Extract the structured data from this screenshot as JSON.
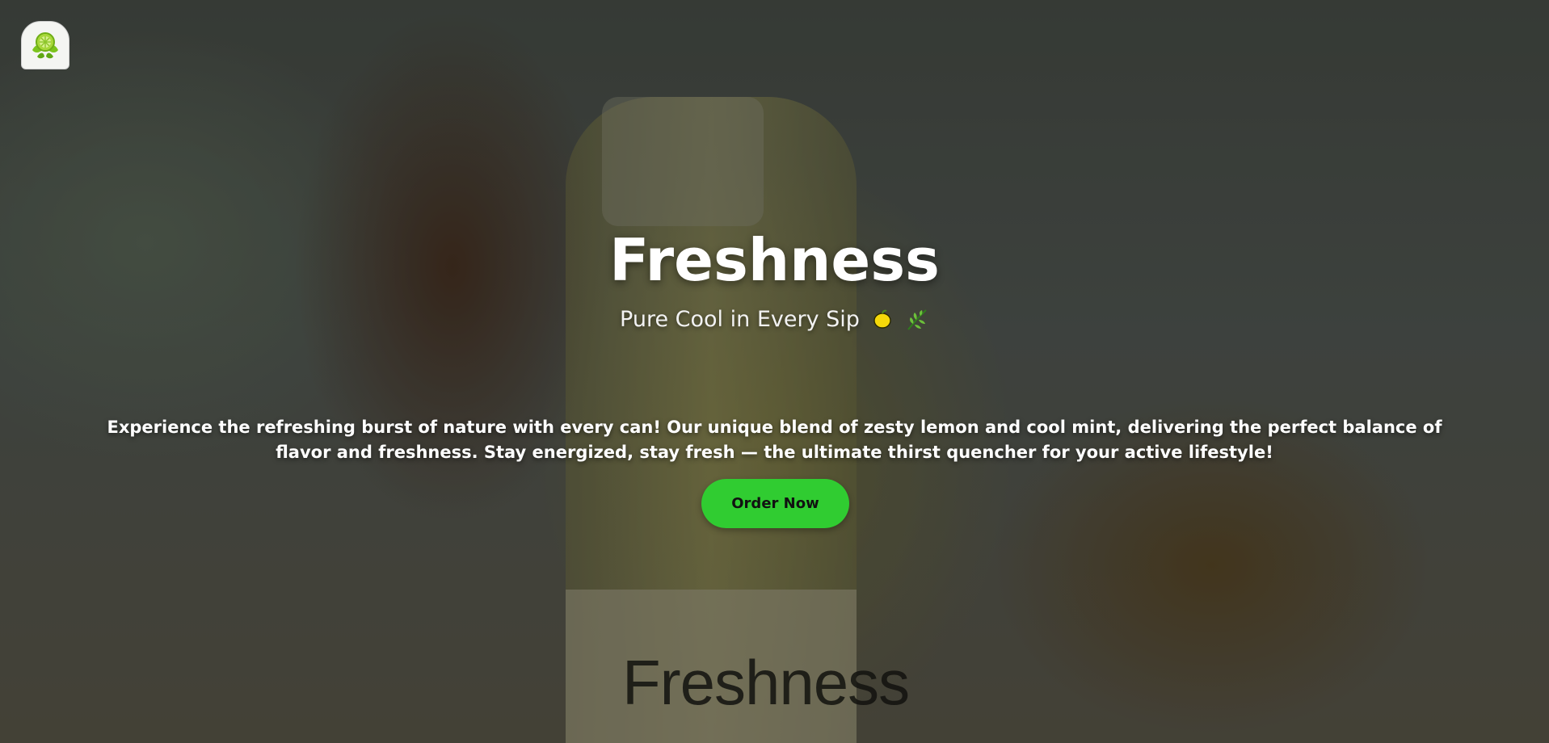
{
  "hero": {
    "logo_icon": "lime-leaves-logo-icon",
    "background_label_text": "Freshness",
    "title": "Freshness",
    "subtitle": "Pure Cool in Every Sip",
    "subtitle_icons": [
      "lemon-icon",
      "herb-leaf-icon"
    ],
    "description": "Experience the refreshing burst of nature with every can! Our unique blend of zesty lemon and cool mint, delivering the perfect balance of flavor and freshness. Stay energized, stay fresh — the ultimate thirst quencher for your active lifestyle!",
    "cta_label": "Order Now"
  },
  "colors": {
    "accent": "#30cc31",
    "text": "#ffffff",
    "logo_bg": "#f4f5f2"
  }
}
